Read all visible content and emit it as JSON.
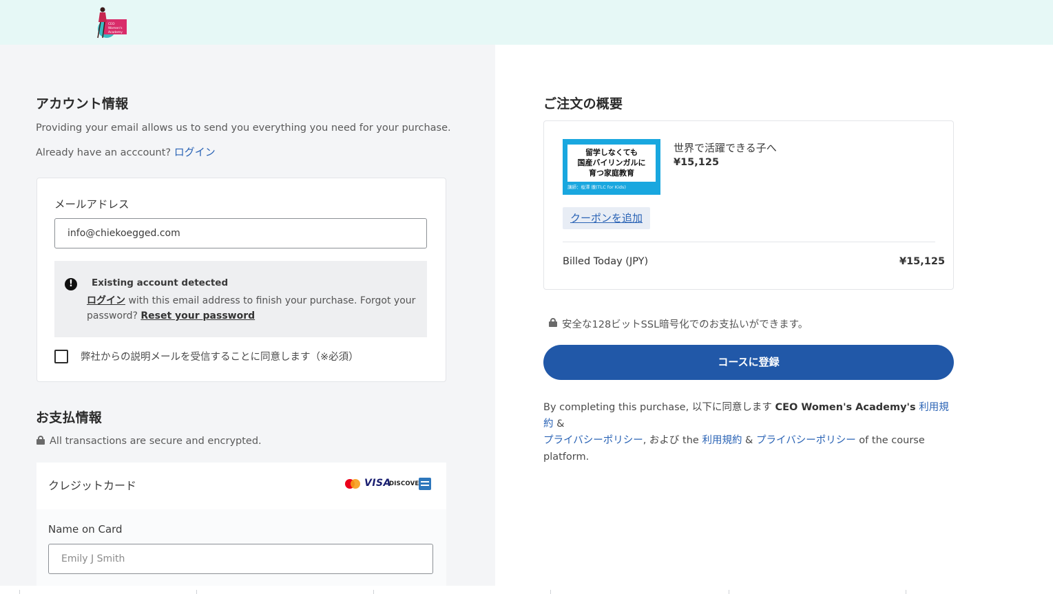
{
  "brand": {
    "logo_icon": "ceo-womens-academy-logo",
    "logo_text": "CEO Women's Academy"
  },
  "account": {
    "title": "アカウント情報",
    "description": "Providing your email allows us to send you everything you need for your purchase.",
    "already_prefix": "Already have an acccount?",
    "login_link": "ログイン",
    "email_label": "メールアドレス",
    "email_value": "info@chiekoegged.com",
    "notice": {
      "title": "Existing account detected",
      "login_link": "ログイン",
      "line1_rest": " with this email address to finish your purchase. Forgot your",
      "line2_prefix": "password?",
      "reset_link": "Reset your password"
    },
    "consent_label": "弊社からの説明メールを受信することに同意します（※必須）"
  },
  "payment": {
    "title": "お支払情報",
    "secure_note": "All transactions are secure and encrypted.",
    "method_label": "クレジットカード",
    "brands": {
      "visa": "VISA",
      "discover": "DISCOVER"
    },
    "name_label": "Name on Card",
    "name_placeholder": "Emily J Smith"
  },
  "order": {
    "title": "ご注文の概要",
    "product": {
      "thumb_lines": [
        "留学しなくても",
        "国産バイリンガルに",
        "育つ家庭教育"
      ],
      "thumb_caption": "講師：桜澤 徹(TLC for Kids)",
      "name": "世界で活躍できる子へ",
      "price": "¥15,125"
    },
    "coupon_link": "クーポンを追加",
    "billed_label": "Billed Today (JPY)",
    "billed_value": "¥15,125",
    "ssl_note": "安全な128ビットSSL暗号化でのお支払いができます。",
    "cta_label": "コースに登録",
    "legal": {
      "p1": "By completing this purchase, 以下に同意します ",
      "company": "CEO Women's Academy's",
      "terms": "利用規約",
      "amp": " & ",
      "privacy": "プライバシーポリシー",
      "p2": ", および the ",
      "terms2": "利用規約",
      "privacy2": "プライバシーポリシー",
      "p3": " of the course platform."
    }
  },
  "colors": {
    "topbar": "#e6f8f6",
    "left_bg": "#f4f5f7",
    "link": "#2a63b5",
    "cta": "#2158a8"
  }
}
